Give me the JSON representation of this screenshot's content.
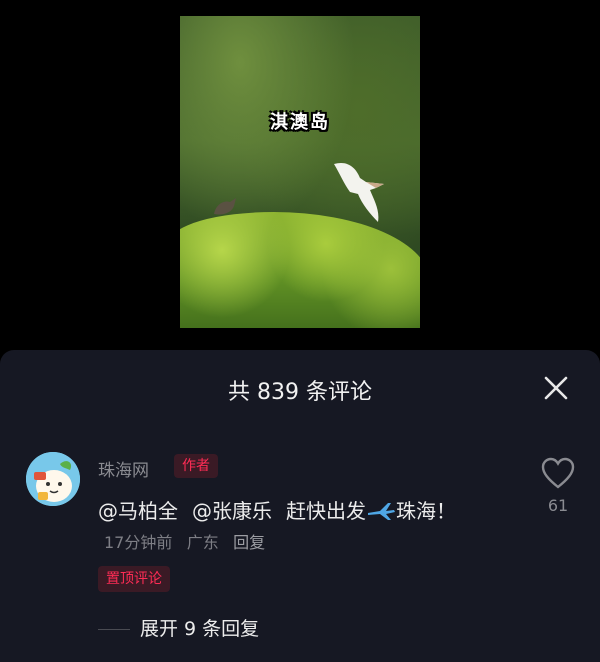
{
  "video": {
    "caption": "淇澳岛"
  },
  "comments_panel": {
    "title": "共 839 条评论",
    "close_icon": "close-icon"
  },
  "comment": {
    "username": "珠海网",
    "author_badge": "作者",
    "mention_1": "@马柏全",
    "mention_2": "@张康乐",
    "text_part1": "赶快出发",
    "airplane_icon": "airplane-icon",
    "text_part2": "珠海！",
    "time": "17分钟前",
    "location": "广东",
    "reply_label": "回复",
    "pinned_badge": "置顶评论",
    "like_icon": "heart-outline-icon",
    "like_count": "61",
    "expand_replies": "展开 9 条回复"
  },
  "colors": {
    "panel_bg": "#161823",
    "accent": "#fe2c55",
    "muted_text": "#8a8b91"
  }
}
